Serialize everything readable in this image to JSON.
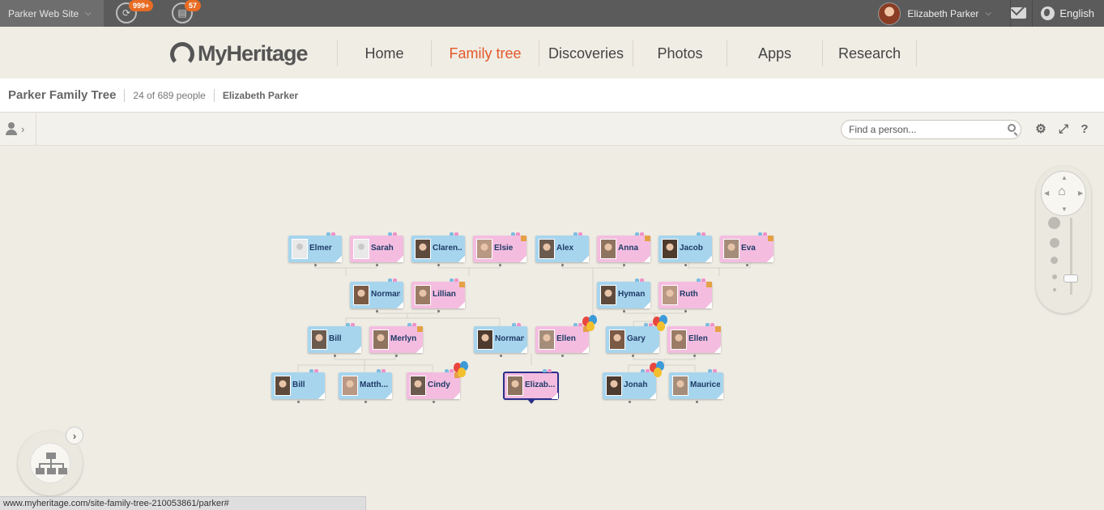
{
  "topbar": {
    "site_name": "Parker Web Site",
    "sync_badge": "999+",
    "tasks_badge": "57",
    "user_name": "Elizabeth Parker",
    "language": "English"
  },
  "header": {
    "logo_text": "MyHeritage",
    "nav": [
      "Home",
      "Family tree",
      "Discoveries",
      "Photos",
      "Apps",
      "Research"
    ],
    "active_nav": "Family tree"
  },
  "breadcrumb": {
    "tree_title": "Parker Family Tree",
    "count": "24 of 689 people",
    "current_person": "Elizabeth Parker"
  },
  "toolbar": {
    "search_placeholder": "Find a person..."
  },
  "tree": {
    "people": [
      {
        "name": "Elmer",
        "gender": "male",
        "photo": "silhouette"
      },
      {
        "name": "Sarah",
        "gender": "female",
        "photo": "silhouette"
      },
      {
        "name": "Claren...",
        "gender": "male",
        "photo": "photo"
      },
      {
        "name": "Elsie",
        "gender": "female",
        "photo": "photo"
      },
      {
        "name": "Alex",
        "gender": "male",
        "photo": "photo"
      },
      {
        "name": "Anna",
        "gender": "female",
        "photo": "photo"
      },
      {
        "name": "Jacob",
        "gender": "male",
        "photo": "photo"
      },
      {
        "name": "Eva",
        "gender": "female",
        "photo": "photo"
      },
      {
        "name": "Norman",
        "gender": "male",
        "photo": "photo"
      },
      {
        "name": "Lillian",
        "gender": "female",
        "photo": "photo"
      },
      {
        "name": "Hyman",
        "gender": "male",
        "photo": "photo"
      },
      {
        "name": "Ruth",
        "gender": "female",
        "photo": "photo"
      },
      {
        "name": "Bill",
        "gender": "male",
        "photo": "photo"
      },
      {
        "name": "Merlyn",
        "gender": "female",
        "photo": "photo"
      },
      {
        "name": "Norman",
        "gender": "male",
        "photo": "photo"
      },
      {
        "name": "Ellen",
        "gender": "female",
        "photo": "photo",
        "birthday": true
      },
      {
        "name": "Gary",
        "gender": "male",
        "photo": "photo",
        "birthday": true
      },
      {
        "name": "Ellen",
        "gender": "female",
        "photo": "photo"
      },
      {
        "name": "Bill",
        "gender": "male",
        "photo": "photo"
      },
      {
        "name": "Matth...",
        "gender": "male",
        "photo": "photo"
      },
      {
        "name": "Cindy",
        "gender": "female",
        "photo": "photo",
        "birthday": true
      },
      {
        "name": "Elizab...",
        "gender": "female",
        "photo": "photo",
        "selected": true
      },
      {
        "name": "Jonah",
        "gender": "male",
        "photo": "photo",
        "birthday": true
      },
      {
        "name": "Maurice",
        "gender": "male",
        "photo": "photo"
      }
    ]
  },
  "statusbar": {
    "url": "www.myheritage.com/site-family-tree-210053861/parker#"
  },
  "colors": {
    "male_card": "#a7d5ee",
    "female_card": "#f4bde0",
    "accent": "#e3592a",
    "selected_outline": "#2a2f8a"
  }
}
